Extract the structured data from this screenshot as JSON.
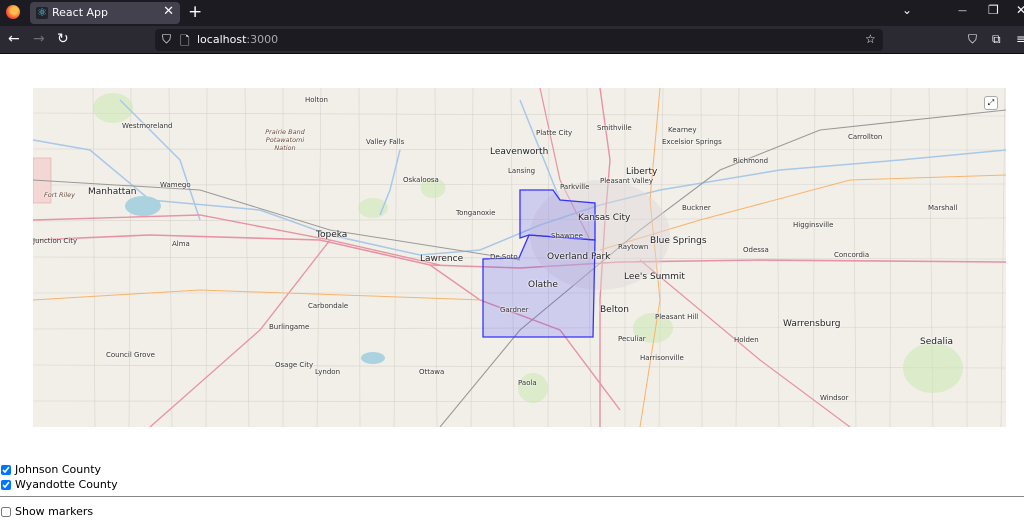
{
  "browser": {
    "tab_title": "React App",
    "url_host": "localhost",
    "url_port": ":3000",
    "new_tab": "+",
    "close_tab": "✕",
    "back": "←",
    "forward": "→",
    "reload": "↻",
    "minimize": "—",
    "restore": "❐",
    "close": "✕",
    "list_all_tabs": "⌄"
  },
  "map": {
    "fullscreen_icon": "⤢",
    "colors": {
      "county_stroke": "#3333ff",
      "county_fill": "#3333ff"
    },
    "labels": [
      "Holton",
      "Westmoreland",
      "Prairie Band Potawatomi Nation",
      "Valley Falls",
      "Platte City",
      "Smithville",
      "Kearney",
      "Carrollton",
      "Leavenworth",
      "Excelsior Springs",
      "Liberty",
      "Richmond",
      "Manhattan",
      "Wamego",
      "Lansing",
      "Oskaloosa",
      "Pleasant Valley",
      "Parkville",
      "Fort Riley",
      "Tonganoxie",
      "Kansas City",
      "Buckner",
      "Marshall",
      "Topeka",
      "Shawnee",
      "Raytown",
      "Blue Springs",
      "Higginsville",
      "Junction City",
      "Alma",
      "Lawrence",
      "De Soto",
      "Overland Park",
      "Odessa",
      "Concordia",
      "Olathe",
      "Lee's Summit",
      "Carbondale",
      "Gardner",
      "Belton",
      "Pleasant Hill",
      "Warrensburg",
      "Burlingame",
      "Holden",
      "Sedalia",
      "Council Grove",
      "Osage City",
      "Peculiar",
      "Harrisonville",
      "Lyndon",
      "Ottawa",
      "Paola",
      "Windsor"
    ]
  },
  "controls": {
    "counties": [
      {
        "label": "Johnson County",
        "checked": true
      },
      {
        "label": "Wyandotte County",
        "checked": true
      }
    ],
    "show_markers": {
      "label": "Show markers",
      "checked": false
    }
  }
}
